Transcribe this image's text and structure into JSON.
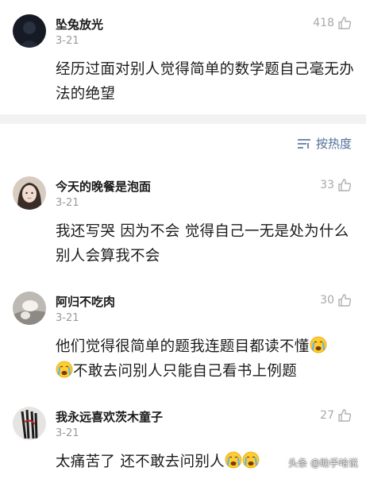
{
  "comments": [
    {
      "username": "坠兔放光",
      "date": "3-21",
      "likes": "418",
      "text": "经历过面对别人觉得简单的数学题自己毫无办法的绝望"
    },
    {
      "username": "今天的晚餐是泡面",
      "date": "3-21",
      "likes": "33",
      "text": "我还写哭 因为不会 觉得自己一无是处为什么别人会算我不会"
    },
    {
      "username": "阿归不吃肉",
      "date": "3-21",
      "likes": "30",
      "text_part1": "他们觉得很简单的题我连题目都读不懂",
      "text_part2": "不敢去问别人只能自己看书上例题"
    },
    {
      "username": "我永远喜欢茨木童子",
      "date": "3-21",
      "likes": "27",
      "text": "太痛苦了 还不敢去问别人"
    }
  ],
  "sort": {
    "label": "按热度",
    "icon": "sort-lines-icon"
  },
  "watermark": "头条 @助手哈说",
  "colors": {
    "link_blue": "#4f6f96",
    "muted_gray": "#9a9a9a",
    "divider": "#f2f2f2"
  }
}
